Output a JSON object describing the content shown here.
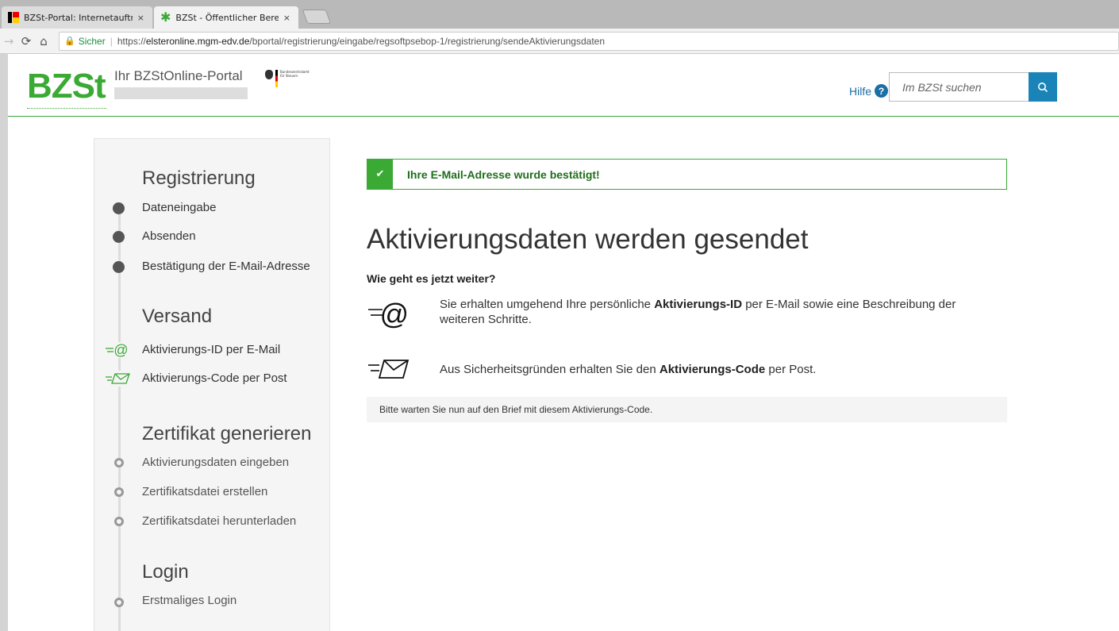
{
  "browser": {
    "tabs": [
      {
        "label": "BZSt-Portal: Internetaufträ",
        "close": "×"
      },
      {
        "label": "BZSt - Öffentlicher Bereich",
        "close": "×"
      }
    ],
    "secure_label": "Sicher",
    "url_prefix": "https://",
    "url_host": "elsteronline.mgm-edv.de",
    "url_path": "/bportal/registrierung/eingabe/regsoftpsebop-1/registrierung/sendeAktivierungsdaten"
  },
  "header": {
    "logo": "BZSt",
    "portal_title": "Ihr BZStOnline-Portal",
    "bund_text": "Bundeszentralamt für Steuern",
    "help_label": "Hilfe",
    "help_icon": "?",
    "search_placeholder": "Im BZSt suchen"
  },
  "sidebar": {
    "sections": {
      "registrierung": {
        "title": "Registrierung",
        "steps": [
          "Dateneingabe",
          "Absenden",
          "Bestätigung der E-Mail-Adresse"
        ]
      },
      "versand": {
        "title": "Versand",
        "steps": [
          "Aktivierungs-ID per E-Mail",
          "Aktivierungs-Code per Post"
        ]
      },
      "zertifikat": {
        "title": "Zertifikat generieren",
        "steps": [
          "Aktivierungsdaten eingeben",
          "Zertifikatsdatei erstellen",
          "Zertifikatsdatei herunterladen"
        ]
      },
      "login": {
        "title": "Login",
        "steps": [
          "Erstmaliges Login"
        ]
      }
    }
  },
  "main": {
    "alert": "Ihre E-Mail-Adresse wurde bestätigt!",
    "title": "Aktivierungsdaten werden gesendet",
    "subtitle": "Wie geht es jetzt weiter?",
    "email_info": {
      "before": "Sie erhalten umgehend Ihre persönliche ",
      "bold": "Aktivierungs-ID",
      "after": " per E-Mail sowie eine Beschreibung der weiteren Schritte."
    },
    "post_info": {
      "before": "Aus Sicherheitsgründen erhalten Sie den ",
      "bold": "Aktivierungs-Code",
      "after": " per Post."
    },
    "notice": "Bitte warten Sie nun auf den Brief mit diesem Aktivierungs-Code."
  },
  "colors": {
    "brand_green": "#3aaa35",
    "link_blue": "#1a6fa5",
    "search_blue": "#1a84b8"
  }
}
